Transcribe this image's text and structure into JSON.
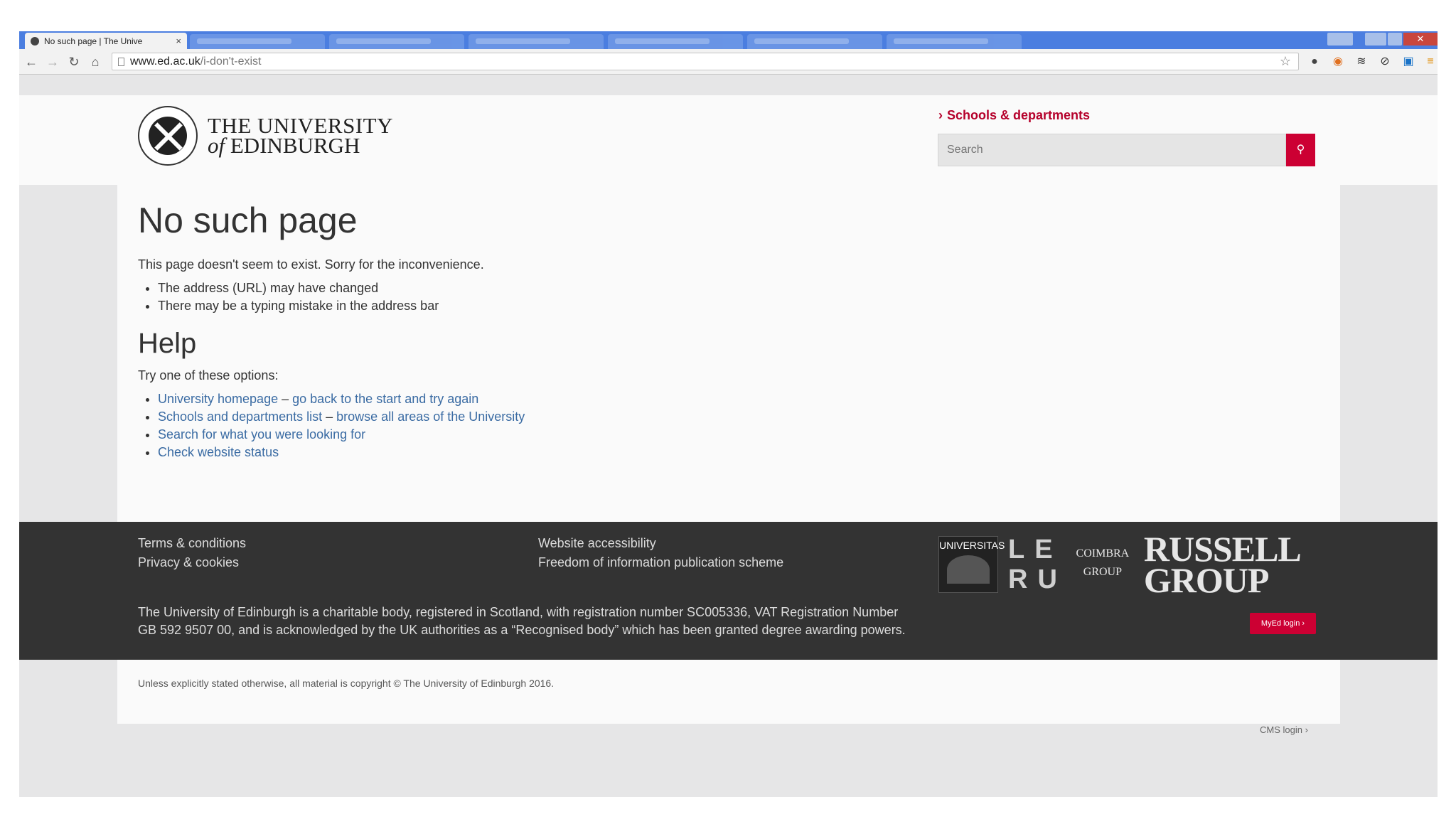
{
  "browser": {
    "tab_title": "No such page | The Unive",
    "tab_close": "×",
    "url_host": "www.ed.ac.uk",
    "url_path": "/i-don't-exist",
    "close_glyph": "✕"
  },
  "header": {
    "logo_line1": "THE UNIVERSITY",
    "logo_line2_italic": "of",
    "logo_line2_rest": "EDINBURGH",
    "schools_link": "Schools & departments",
    "search_placeholder": "Search"
  },
  "main": {
    "heading": "No such page",
    "intro": "This page doesn't seem to exist. Sorry for the inconvenience.",
    "reasons": [
      "The address (URL) may have changed",
      "There may be a typing mistake in the address bar"
    ],
    "help_heading": "Help",
    "help_intro": "Try one of these options:",
    "options": [
      {
        "link": "University homepage",
        "sep": " – ",
        "rest": "go back to the start and try again"
      },
      {
        "link": "Schools and departments list",
        "sep": " – ",
        "rest": "browse all areas of the University"
      },
      {
        "link": "Search for what you were looking for",
        "sep": "",
        "rest": ""
      },
      {
        "link": "Check website status",
        "sep": "",
        "rest": ""
      }
    ]
  },
  "footer": {
    "links_col1": [
      "Terms & conditions",
      "Privacy & cookies"
    ],
    "links_col2": [
      "Website accessibility",
      "Freedom of information publication scheme"
    ],
    "legal": "The University of Edinburgh is a charitable body, registered in Scotland, with registration number SC005336, VAT Registration Number GB 592 9507 00, and is acknowledged by the UK authorities as a “Recognised body” which has been granted degree awarding powers.",
    "partner_u21": "UNIVERSITAS",
    "partner_leru_1": "LE",
    "partner_leru_2": "RU",
    "partner_coimbra_1": "COIMBRA",
    "partner_coimbra_2": "GROUP",
    "partner_russell_1": "RUSSELL",
    "partner_russell_2": "GROUP",
    "myed_login": "MyEd login",
    "copyright": "Unless explicitly stated otherwise, all material is copyright © The University of Edinburgh 2016.",
    "cms_login": "CMS login"
  },
  "colors": {
    "brand_red": "#cc0033",
    "link_blue": "#3a6ba3",
    "footer_bg": "#333333"
  }
}
